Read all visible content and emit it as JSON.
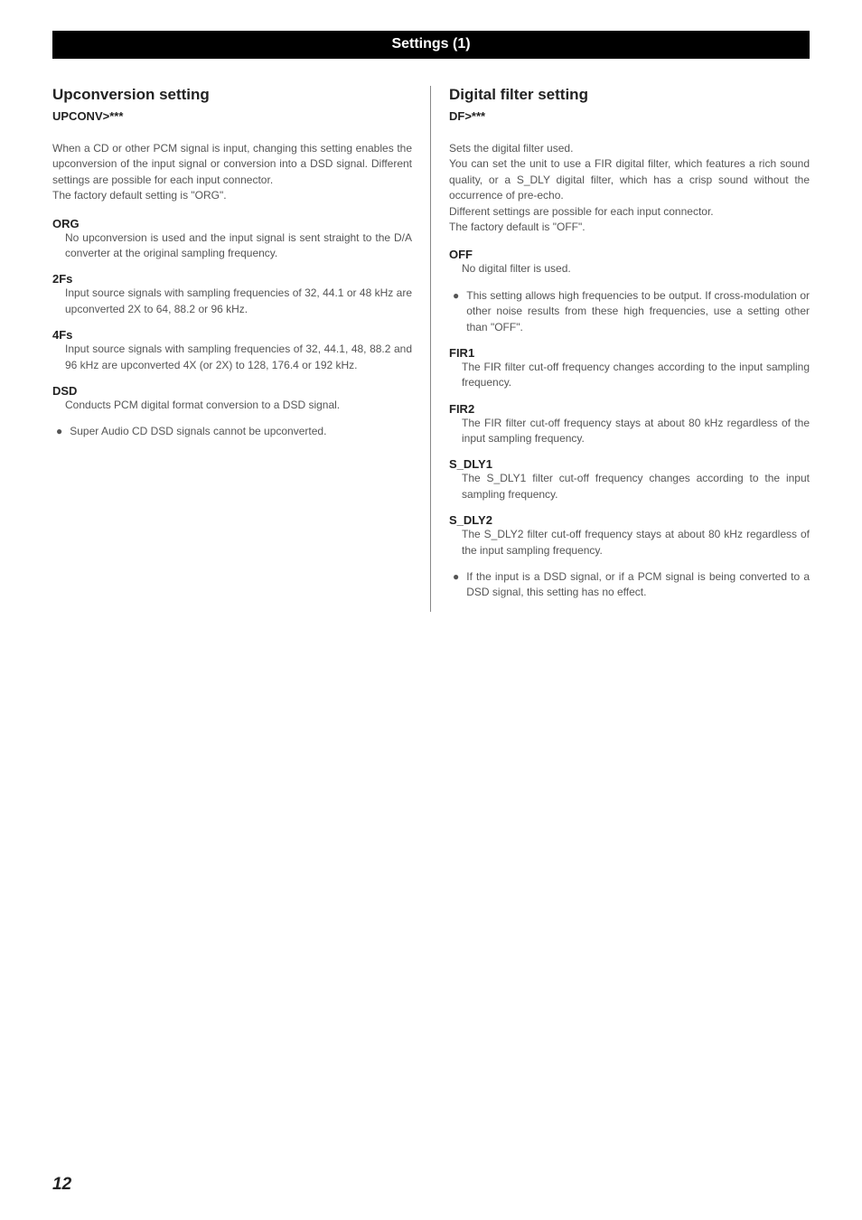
{
  "bar_title": "Settings (1)",
  "left": {
    "heading": "Upconversion setting",
    "code": "UPCONV>***",
    "intro": "When a CD or other PCM signal is input, changing this setting enables the upconversion of the input signal or conversion into a DSD signal. Different settings are possible for each input connector.\nThe factory default setting is \"ORG\".",
    "options": [
      {
        "title": "ORG",
        "body": "No upconversion is used and the input signal is sent straight to the D/A converter at the original sampling frequency."
      },
      {
        "title": "2Fs",
        "body": "Input source signals with sampling frequencies of 32, 44.1 or 48 kHz are upconverted 2X to 64, 88.2 or 96 kHz."
      },
      {
        "title": "4Fs",
        "body": "Input source signals with sampling frequencies of 32, 44.1, 48, 88.2 and 96 kHz are upconverted 4X (or 2X) to 128, 176.4 or 192 kHz."
      },
      {
        "title": "DSD",
        "body": "Conducts PCM digital format conversion to a DSD signal."
      }
    ],
    "note": "Super Audio CD DSD signals cannot be upconverted."
  },
  "right": {
    "heading": "Digital filter setting",
    "code": "DF>***",
    "intro": "Sets the digital filter used.\nYou can set the unit to use a FIR digital filter, which features a rich sound quality, or a S_DLY digital filter, which has a crisp sound without the occurrence of pre-echo.\nDifferent settings are possible for each input connector.\nThe factory default is \"OFF\".",
    "off": {
      "title": "OFF",
      "body": "No digital filter is used."
    },
    "off_note": "This setting allows high frequencies to be output. If cross-modulation or other noise results from these high frequencies, use a setting other than \"OFF\".",
    "options": [
      {
        "title": "FIR1",
        "body": "The FIR filter cut-off frequency changes according to the input sampling frequency."
      },
      {
        "title": "FIR2",
        "body": "The FIR filter cut-off frequency stays at about 80 kHz regardless of the input sampling frequency."
      },
      {
        "title": "S_DLY1",
        "body": "The S_DLY1 filter cut-off frequency changes according to the input sampling frequency."
      },
      {
        "title": "S_DLY2",
        "body": "The S_DLY2 filter cut-off frequency stays at about 80 kHz regardless of the input sampling frequency."
      }
    ],
    "end_note": "If the input is a DSD signal, or if a PCM signal is being converted to a DSD signal, this setting has no effect."
  },
  "page_number": "12",
  "bullet_glyph": "●"
}
